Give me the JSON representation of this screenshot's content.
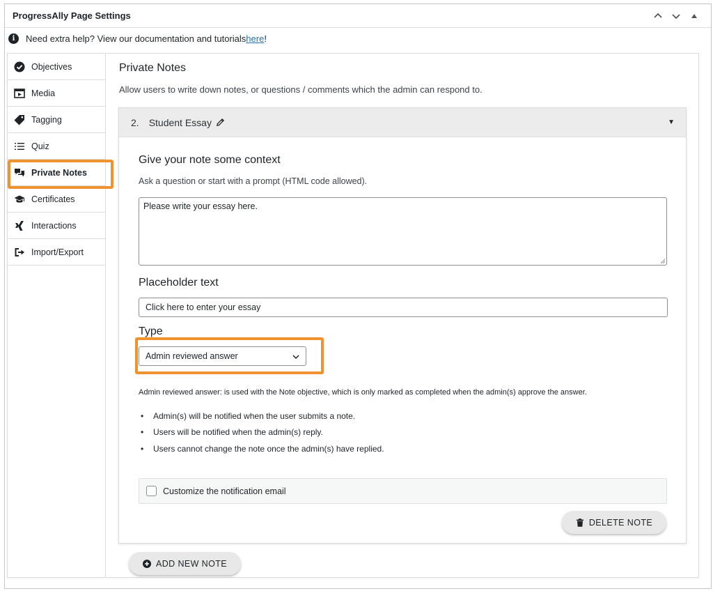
{
  "panel": {
    "title": "ProgressAlly Page Settings",
    "controls": [
      "chevron-up-icon",
      "chevron-down-icon",
      "triangle-up-icon"
    ]
  },
  "help": {
    "text": "Need extra help? View our documentation and tutorials ",
    "link": "here",
    "suffix": "!"
  },
  "sidebar": {
    "items": [
      {
        "label": "Objectives",
        "icon": "check-circle-icon"
      },
      {
        "label": "Media",
        "icon": "film-icon"
      },
      {
        "label": "Tagging",
        "icon": "tag-icon"
      },
      {
        "label": "Quiz",
        "icon": "list-icon"
      },
      {
        "label": "Private Notes",
        "icon": "comments-icon",
        "active": true
      },
      {
        "label": "Certificates",
        "icon": "graduation-cap-icon"
      },
      {
        "label": "Interactions",
        "icon": "xing-icon"
      },
      {
        "label": "Import/Export",
        "icon": "sign-out-icon"
      }
    ]
  },
  "main": {
    "title": "Private Notes",
    "description": "Allow users to write down notes, or questions / comments which the admin can respond to.",
    "note": {
      "number": "2.",
      "name": "Student Essay",
      "context_label": "Give your note some context",
      "context_help": "Ask a question or start with a prompt (HTML code allowed).",
      "context_value": "Please write your essay here.",
      "placeholder_label": "Placeholder text",
      "placeholder_value": "Click here to enter your essay",
      "type_label": "Type",
      "type_value": "Admin reviewed answer",
      "type_description": "Admin reviewed answer: is used with the Note objective, which is only marked as completed when the admin(s) approve the answer.",
      "bullets": [
        "Admin(s) will be notified when the user submits a note.",
        "Users will be notified when the admin(s) reply.",
        "Users cannot change the note once the admin(s) have replied."
      ],
      "customize_label": "Customize the notification email",
      "delete_label": "DELETE NOTE"
    },
    "add_label": "ADD NEW NOTE"
  },
  "colors": {
    "highlight": "#f0932e",
    "link": "#2271b1"
  }
}
